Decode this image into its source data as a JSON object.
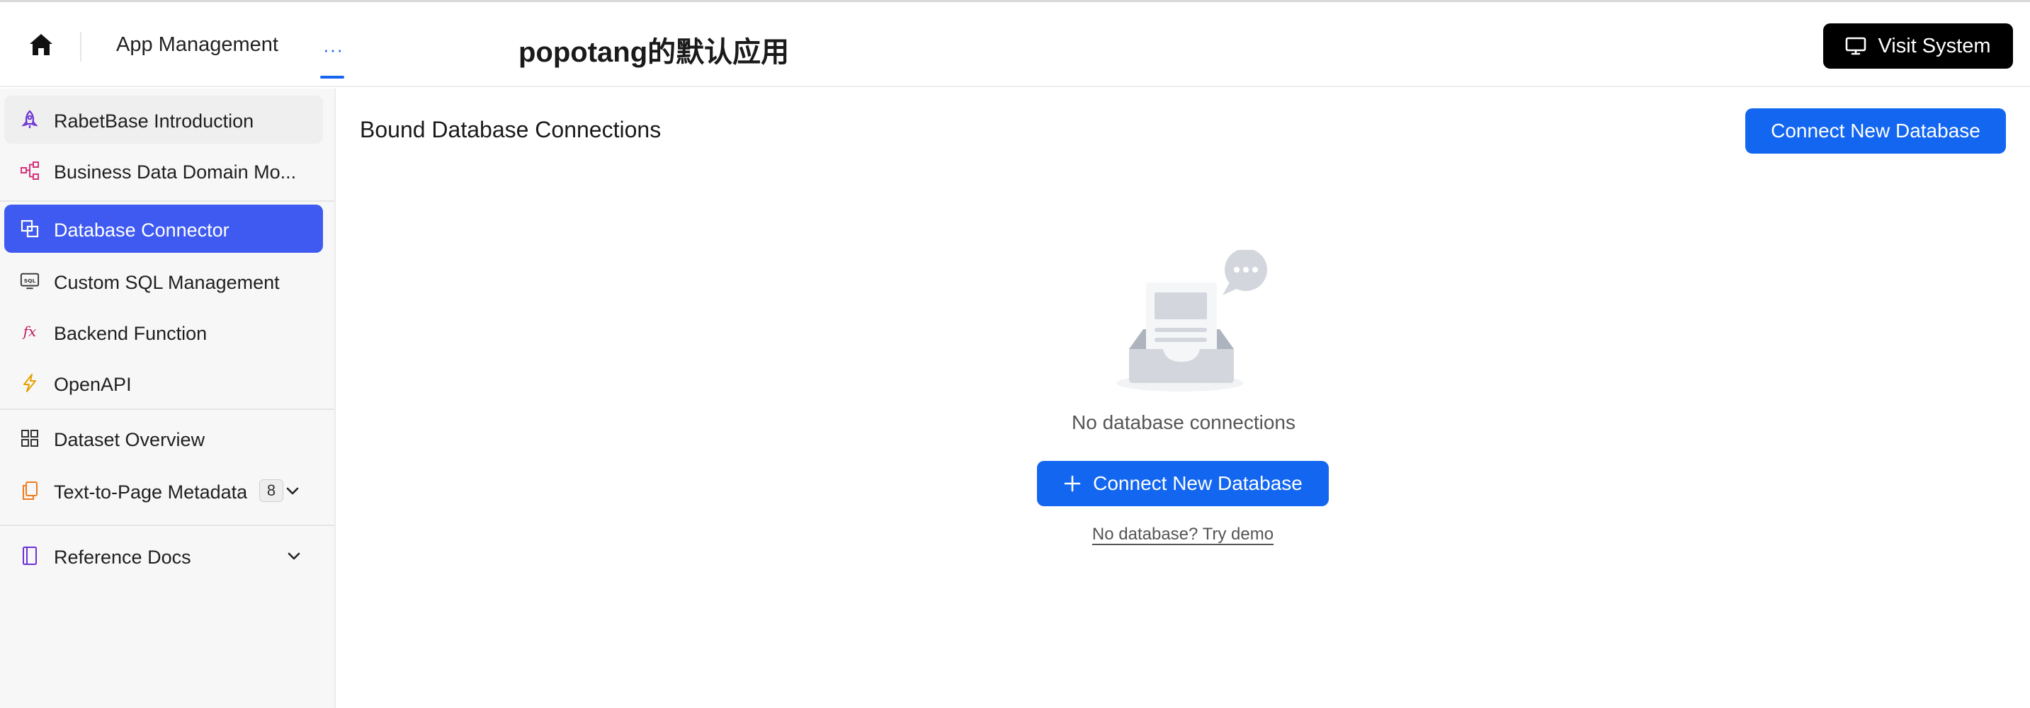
{
  "header": {
    "home_icon": "home-icon",
    "app_management": "App Management",
    "more_label": "···",
    "app_title": "popotang的默认应用",
    "visit_system": "Visit System",
    "visit_icon": "monitor-icon"
  },
  "sidebar": {
    "items": [
      {
        "label": "RabetBase Introduction",
        "icon": "rocket-icon",
        "color": "#6b32d6"
      },
      {
        "label": "Business Data Domain Mo...",
        "icon": "diagram-icon",
        "color": "#d6337a"
      },
      {
        "label": "Database Connector",
        "icon": "copy-icon",
        "color": "#ffffff"
      },
      {
        "label": "Custom SQL Management",
        "icon": "sql-icon",
        "color": "#333333"
      },
      {
        "label": "Backend Function",
        "icon": "fx-icon",
        "color": "#c2185b"
      },
      {
        "label": "OpenAPI",
        "icon": "bolt-icon",
        "color": "#e6a100"
      },
      {
        "label": "Dataset Overview",
        "icon": "grid-icon",
        "color": "#333333"
      },
      {
        "label": "Text-to-Page Metadata",
        "icon": "pages-icon",
        "color": "#f07b1a",
        "badge": "8"
      },
      {
        "label": "Reference Docs",
        "icon": "book-icon",
        "color": "#6b32d6"
      }
    ]
  },
  "main": {
    "title": "Bound Database Connections",
    "connect_button": "Connect New Database",
    "empty_text": "No database connections",
    "center_button": "Connect New Database",
    "demo_link": "No database? Try demo"
  },
  "colors": {
    "accent": "#1366f0",
    "active_nav": "#3f5af0",
    "visit_bg": "#000000"
  }
}
